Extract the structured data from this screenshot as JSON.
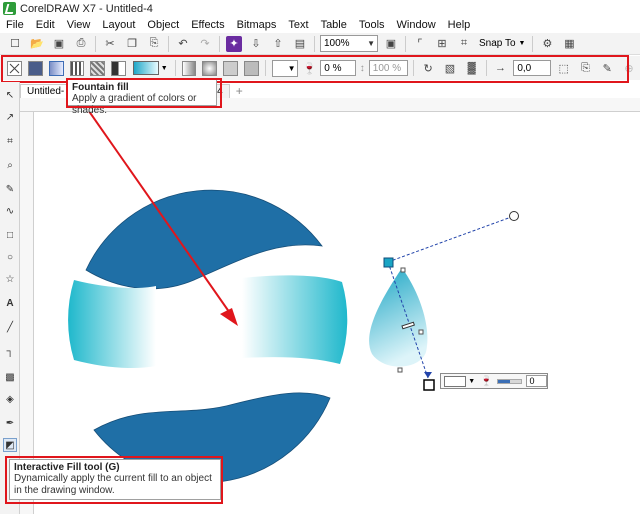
{
  "window": {
    "title": "CorelDRAW X7 - Untitled-4"
  },
  "menu": [
    "File",
    "Edit",
    "View",
    "Layout",
    "Object",
    "Effects",
    "Bitmaps",
    "Text",
    "Table",
    "Tools",
    "Window",
    "Help"
  ],
  "standard_toolbar": {
    "zoom_value": "100%",
    "snap_label": "Snap To"
  },
  "property_bar": {
    "transparency_value": "0 %",
    "opacity_value": "100 %",
    "offset_value": "0,0"
  },
  "tabs": [
    {
      "label": "Untitled-",
      "active": true
    },
    {
      "label": "d-4",
      "active": false
    }
  ],
  "tooltips": {
    "fountain_fill": {
      "title": "Fountain fill",
      "description": "Apply a gradient of colors or shades."
    },
    "interactive_fill": {
      "title": "Interactive Fill tool (G)",
      "description": "Dynamically apply the current fill to an object in the drawing window."
    }
  },
  "interactive_fill_panel": {
    "value": "0",
    "transparency_level": 0.5
  },
  "colors": {
    "circle_blue": "#1f6fa6",
    "gradient_cyan": "#1fb8cc",
    "highlight_red": "#e0161c",
    "handle_cyan": "#1aa5c4"
  }
}
